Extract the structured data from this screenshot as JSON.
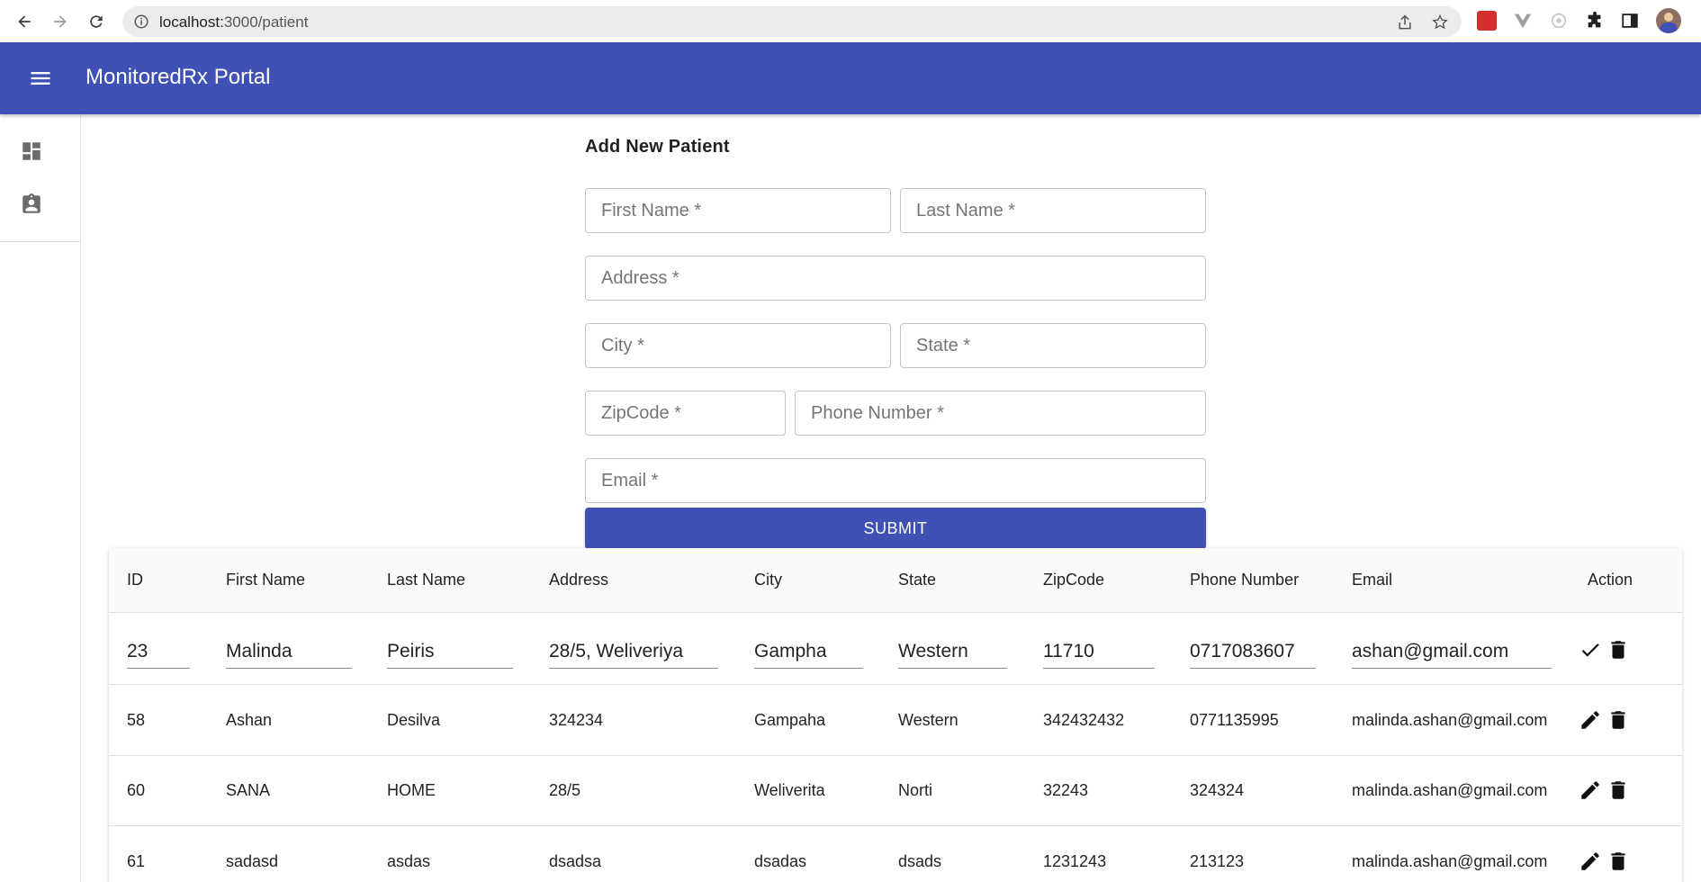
{
  "browser": {
    "url_host": "localhost:",
    "url_path": "3000/patient",
    "icons": [
      "back-icon",
      "forward-icon",
      "reload-icon",
      "info-icon",
      "share-icon",
      "star-icon",
      "extension-icons",
      "puzzle-icon",
      "sidepanel-icon",
      "profile-avatar"
    ]
  },
  "appbar": {
    "title": "MonitoredRx Portal",
    "color": "#3f51b5"
  },
  "drawer": {
    "items": [
      {
        "icon": "dashboard-icon"
      },
      {
        "icon": "patient-icon"
      }
    ]
  },
  "form": {
    "title": "Add New Patient",
    "fields": {
      "first_name": "First Name *",
      "last_name": "Last Name *",
      "address": "Address *",
      "city": "City *",
      "state": "State *",
      "zipcode": "ZipCode *",
      "phone": "Phone Number *",
      "email": "Email *"
    },
    "submit_label": "SUBMIT"
  },
  "table": {
    "columns": [
      "ID",
      "First Name",
      "Last Name",
      "Address",
      "City",
      "State",
      "ZipCode",
      "Phone Number",
      "Email",
      "Action"
    ],
    "editing_row": {
      "id": "23",
      "first_name": "Malinda",
      "last_name": "Peiris",
      "address": "28/5, Weliveriya",
      "city": "Gampha",
      "state": "Western",
      "zipcode": "11710",
      "phone": "0717083607",
      "email": "ashan@gmail.com"
    },
    "rows": [
      {
        "id": "58",
        "first_name": "Ashan",
        "last_name": "Desilva",
        "address": "324234",
        "city": "Gampaha",
        "state": "Western",
        "zipcode": "342432432",
        "phone": "0771135995",
        "email": "malinda.ashan@gmail.com"
      },
      {
        "id": "60",
        "first_name": "SANA",
        "last_name": "HOME",
        "address": "28/5",
        "city": "Weliverita",
        "state": "Norti",
        "zipcode": "32243",
        "phone": "324324",
        "email": "malinda.ashan@gmail.com"
      },
      {
        "id": "61",
        "first_name": "sadasd",
        "last_name": "asdas",
        "address": "dsadsa",
        "city": "dsadas",
        "state": "dsads",
        "zipcode": "1231243",
        "phone": "213123",
        "email": "malinda.ashan@gmail.com"
      }
    ]
  }
}
